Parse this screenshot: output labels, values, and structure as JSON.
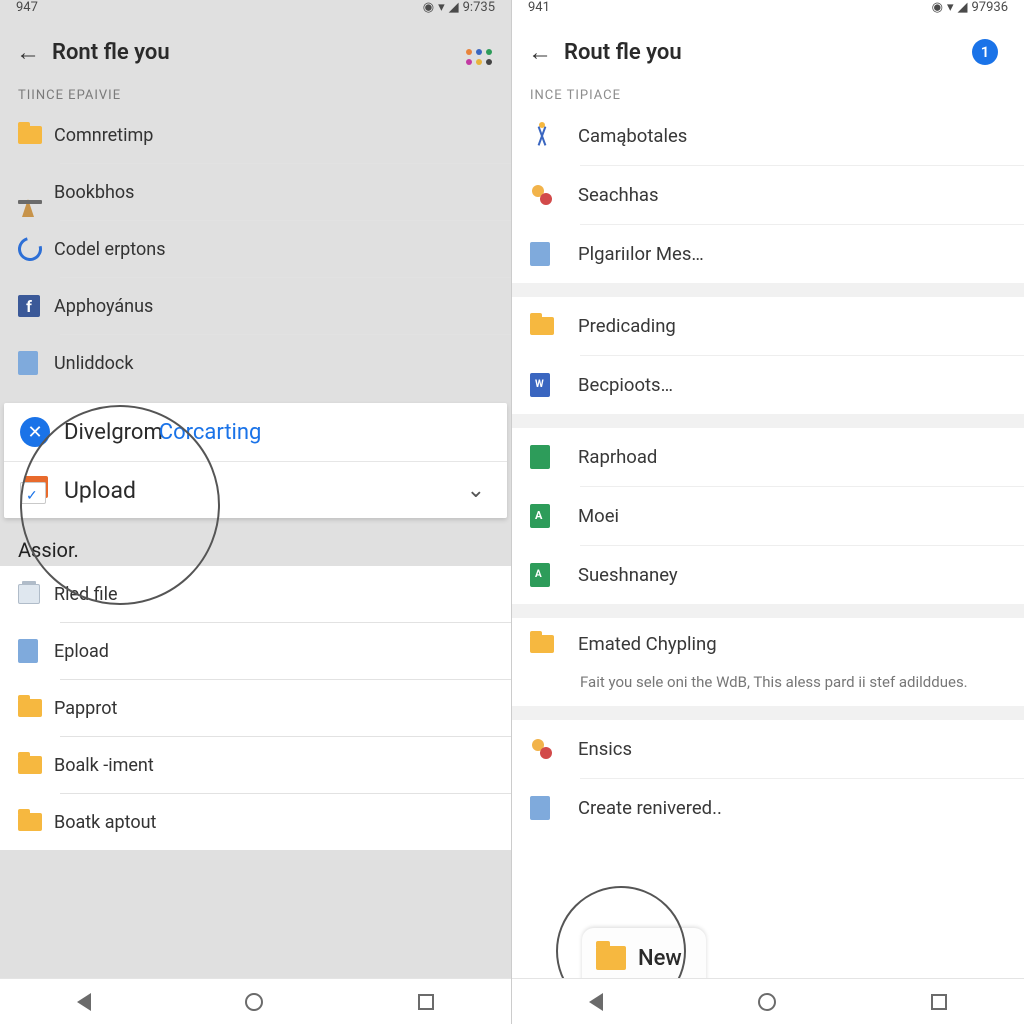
{
  "left": {
    "status": {
      "time": "947",
      "right": "9:735"
    },
    "appbar": {
      "title": "Ront fle you"
    },
    "section1_label": "TIINCE EPAIVIE",
    "items1": [
      {
        "label": "Comnretimp"
      },
      {
        "label": "Bookbhos"
      },
      {
        "label": "Codel erptons"
      },
      {
        "label": "Apphoyánus"
      },
      {
        "label": "Unliddock"
      }
    ],
    "card": {
      "divelgrom": "Divelgrom",
      "corcarting": "Corcarting",
      "upload": "Upload"
    },
    "assi": "Assior.",
    "items2": [
      {
        "label": "Rled file"
      },
      {
        "label": "Epload"
      },
      {
        "label": "Papprot"
      },
      {
        "label": "Boalk -iment"
      },
      {
        "label": "Boatk aptout"
      }
    ]
  },
  "right": {
    "status": {
      "time": "941",
      "right": "97936"
    },
    "appbar": {
      "title": "Rout fle you",
      "badge": "1"
    },
    "section_label": "INCE TIPIACE",
    "groupA": [
      {
        "label": "Camąbotales"
      },
      {
        "label": "Seachhas"
      },
      {
        "label": "Plgariılor Mes…"
      }
    ],
    "groupB": [
      {
        "label": "Predicading"
      },
      {
        "label": "Becpioots…"
      }
    ],
    "groupC": [
      {
        "label": "Raprhoad"
      },
      {
        "label": "Moei"
      },
      {
        "label": "Sueshnaney"
      }
    ],
    "groupD_title": "Emated Chypling",
    "groupD_sub": "Fait you sele oni the WdB, This aless pard ii stef adilddues.",
    "groupE": [
      {
        "label": "Ensics"
      },
      {
        "label": "Create renivered.."
      }
    ],
    "new_label": "New"
  }
}
